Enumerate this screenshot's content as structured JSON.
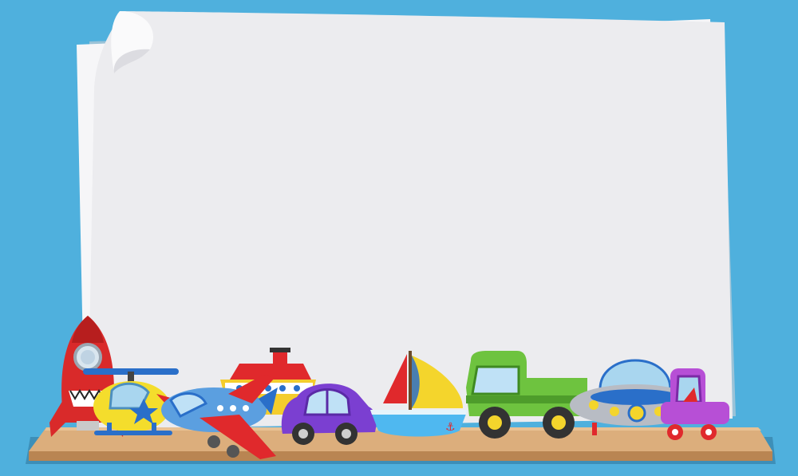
{
  "scene": {
    "background_color": "#4fb0dd",
    "paper_color": "#ececef",
    "paper_back_color": "#f6f6f8",
    "shelf_color": "#dcae7c",
    "shelf_edge_color": "#b98552",
    "shelf_shadow_color": "#3d8fb8"
  },
  "toys": [
    {
      "name": "rocket",
      "icon": "rocket-icon"
    },
    {
      "name": "helicopter",
      "icon": "helicopter-icon"
    },
    {
      "name": "ship",
      "icon": "ship-icon"
    },
    {
      "name": "airplane",
      "icon": "airplane-icon"
    },
    {
      "name": "car",
      "icon": "car-icon"
    },
    {
      "name": "sailboat",
      "icon": "sailboat-icon"
    },
    {
      "name": "pickup-truck",
      "icon": "truck-icon"
    },
    {
      "name": "ufo",
      "icon": "ufo-icon"
    },
    {
      "name": "buggy",
      "icon": "buggy-icon"
    }
  ]
}
